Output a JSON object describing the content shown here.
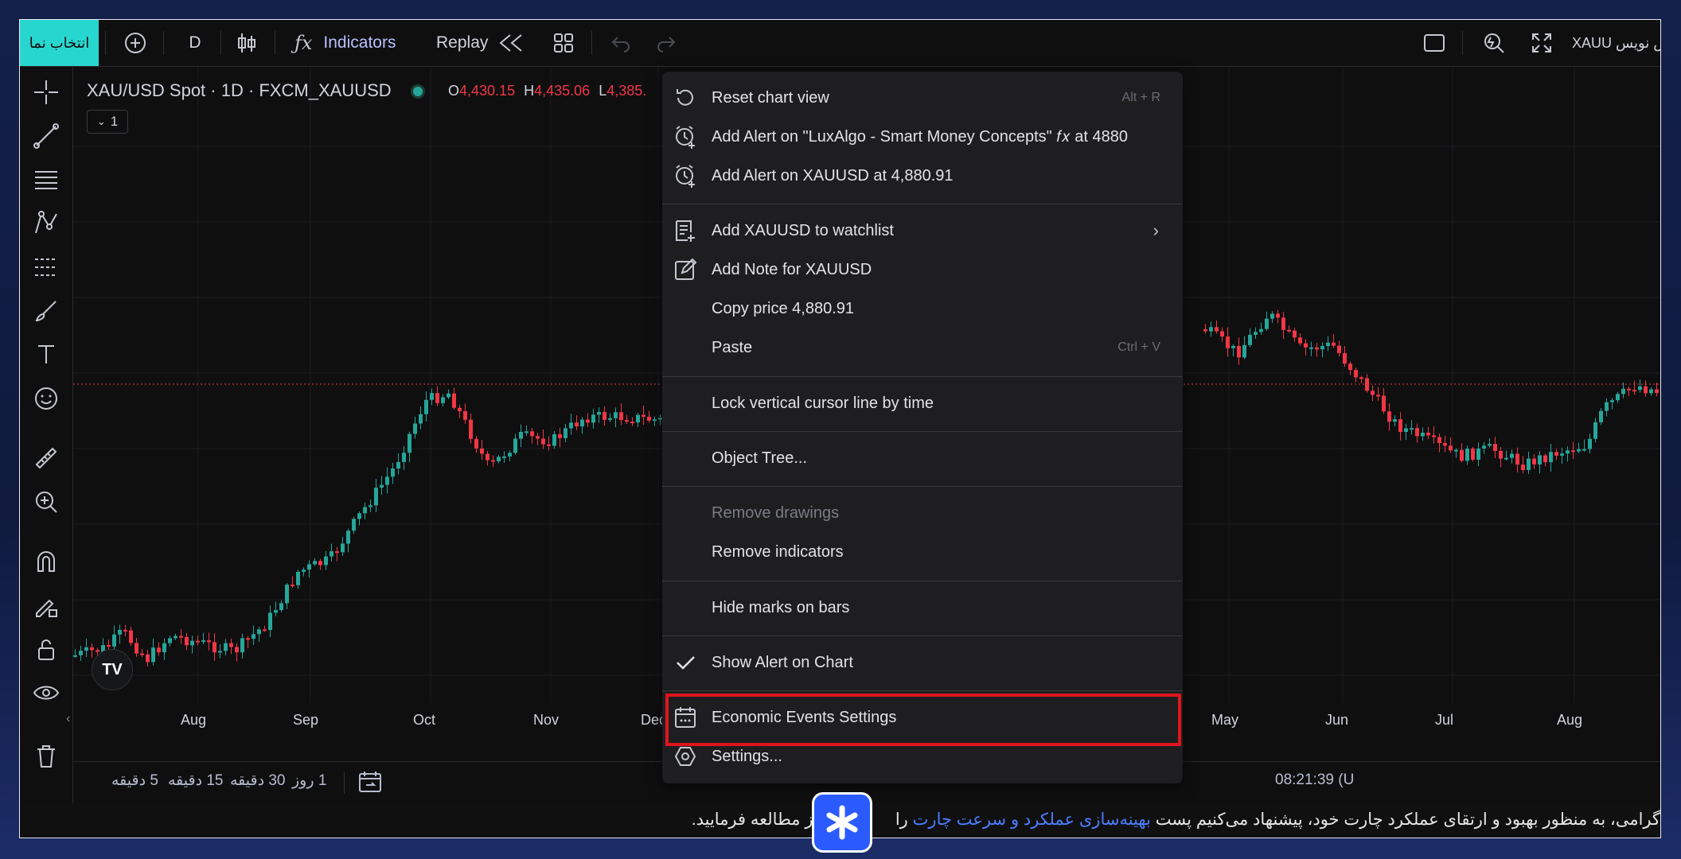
{
  "topbar": {
    "select_symbol": "انتخاب نما",
    "interval": "D",
    "indicators": "Indicators",
    "replay": "Replay",
    "symbol_right": "XAUU پیش نویس"
  },
  "legend": {
    "title": "XAU/USD Spot · 1D · FXCM_XAUUSD",
    "open_label": "O",
    "open_value": "4,430.15",
    "high_label": "H",
    "high_value": "4,435.06",
    "low_label": "L",
    "low_value": "4,385.",
    "collapse_count": "1"
  },
  "x_axis_left": [
    "Aug",
    "Sep",
    "Oct",
    "Nov",
    "Dec"
  ],
  "x_axis_right": [
    "May",
    "Jun",
    "Jul",
    "Aug"
  ],
  "bottombar": {
    "tf_5m": "5 دقیقه",
    "tf_15m": "15 دقیقه",
    "tf_30m": "30 دقیقه",
    "tf_1d": "1 روز",
    "clock": "08:21:39 (U"
  },
  "notice": {
    "before": "گرامی، به منظور بهبود و ارتقای عملکرد چارت خود، پیشنهاد می‌کنیم پست ",
    "link": "بهینه‌سازی عملکرد و سرعت چارت",
    "after": " را ",
    "end": "فراز مطالعه فرمایید."
  },
  "menu": {
    "reset": "Reset chart view",
    "reset_sc": "Alt + R",
    "alert_lux": "Add Alert on \"LuxAlgo - Smart Money Concepts\" 𝑓𝑥 at 4880",
    "alert_xau": "Add Alert on XAUUSD at 4,880.91",
    "watchlist": "Add XAUUSD to watchlist",
    "note": "Add Note for XAUUSD",
    "copy_price": "Copy price 4,880.91",
    "paste": "Paste",
    "paste_sc": "Ctrl + V",
    "lock_cursor": "Lock vertical cursor line by time",
    "object_tree": "Object Tree...",
    "remove_drawings": "Remove drawings",
    "remove_indicators": "Remove indicators",
    "hide_marks": "Hide marks on bars",
    "show_alert": "Show Alert on Chart",
    "economic_events": "Economic Events Settings",
    "settings": "Settings..."
  },
  "colors": {
    "accent": "#27d7cf",
    "up": "#26a69a",
    "down": "#f23645",
    "highlight": "#e1141c",
    "link": "#4b7dff"
  }
}
